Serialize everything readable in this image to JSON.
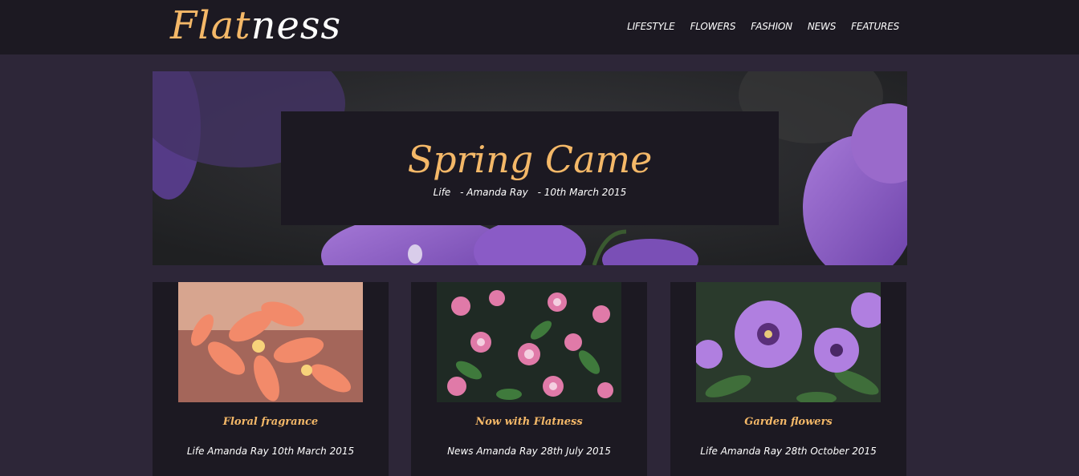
{
  "site": {
    "logo_part1": "Flat",
    "logo_part2": "ness"
  },
  "nav": {
    "items": [
      {
        "label": "LIFESTYLE"
      },
      {
        "label": "FLOWERS"
      },
      {
        "label": "FASHION"
      },
      {
        "label": "NEWS"
      },
      {
        "label": "FEATURES"
      }
    ]
  },
  "hero": {
    "title": "Spring Came",
    "category": "Life",
    "author": "- Amanda Ray",
    "date": "- 10th March 2015"
  },
  "posts": [
    {
      "title": "Floral fragrance",
      "meta": "Life Amanda Ray 10th March 2015"
    },
    {
      "title": "Now with Flatness",
      "meta": "News Amanda Ray 28th July 2015"
    },
    {
      "title": "Garden flowers",
      "meta": "Life Amanda Ray 28th October 2015"
    }
  ],
  "colors": {
    "accent": "#f4b868",
    "header_bg": "#1c1922",
    "page_bg": "#2d2638",
    "flower_purple": "#8b5cc6"
  }
}
